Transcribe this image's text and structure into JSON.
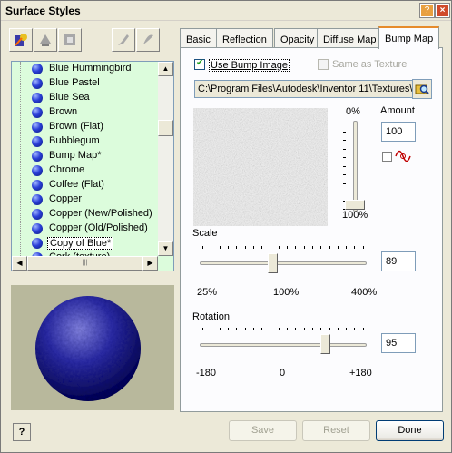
{
  "window": {
    "title": "Surface Styles"
  },
  "toolbar": {
    "icons": [
      "new-style-icon",
      "purge-style-icon",
      "delete-style-icon",
      "paste-style-icon",
      "apply-style-icon"
    ]
  },
  "styles_list": {
    "items": [
      {
        "label": "Blue Hummingbird"
      },
      {
        "label": "Blue Pastel"
      },
      {
        "label": "Blue Sea"
      },
      {
        "label": "Brown"
      },
      {
        "label": "Brown (Flat)"
      },
      {
        "label": "Bubblegum"
      },
      {
        "label": "Bump Map*"
      },
      {
        "label": "Chrome"
      },
      {
        "label": "Coffee (Flat)"
      },
      {
        "label": "Copper"
      },
      {
        "label": "Copper (New/Polished)"
      },
      {
        "label": "Copper (Old/Polished)"
      },
      {
        "label": "Copy of Blue*"
      },
      {
        "label": "Cork (texture)"
      }
    ],
    "selected_index": 12
  },
  "tabs": [
    {
      "label": "Basic"
    },
    {
      "label": "Reflection"
    },
    {
      "label": "Opacity"
    },
    {
      "label": "Diffuse Map"
    },
    {
      "label": "Bump Map"
    }
  ],
  "active_tab": "Bump Map",
  "bump_map": {
    "use_bump_image_label": "Use Bump Image",
    "use_bump_image_checked": true,
    "same_as_texture_label": "Same as Texture",
    "same_as_texture_checked": false,
    "path": "C:\\Program Files\\Autodesk\\Inventor 11\\Textures\\",
    "amount_label": "Amount",
    "amount_value": "100",
    "amount_top_label": "0%",
    "amount_bottom_label": "100%",
    "amount_level": 1.0,
    "scale_label": "Scale",
    "scale_value": "89",
    "scale_ticks": {
      "left": "25%",
      "mid": "100%",
      "right": "400%"
    },
    "rotation_label": "Rotation",
    "rotation_value": "95",
    "rotation_ticks": {
      "left": "-180",
      "mid": "0",
      "right": "+180"
    }
  },
  "buttons": {
    "save": "Save",
    "reset": "Reset",
    "done": "Done",
    "help": "?"
  },
  "colors": {
    "list_bg": "#dcfcdc",
    "sphere": "#2a2a9a",
    "preview_bg": "#b8b89c"
  }
}
